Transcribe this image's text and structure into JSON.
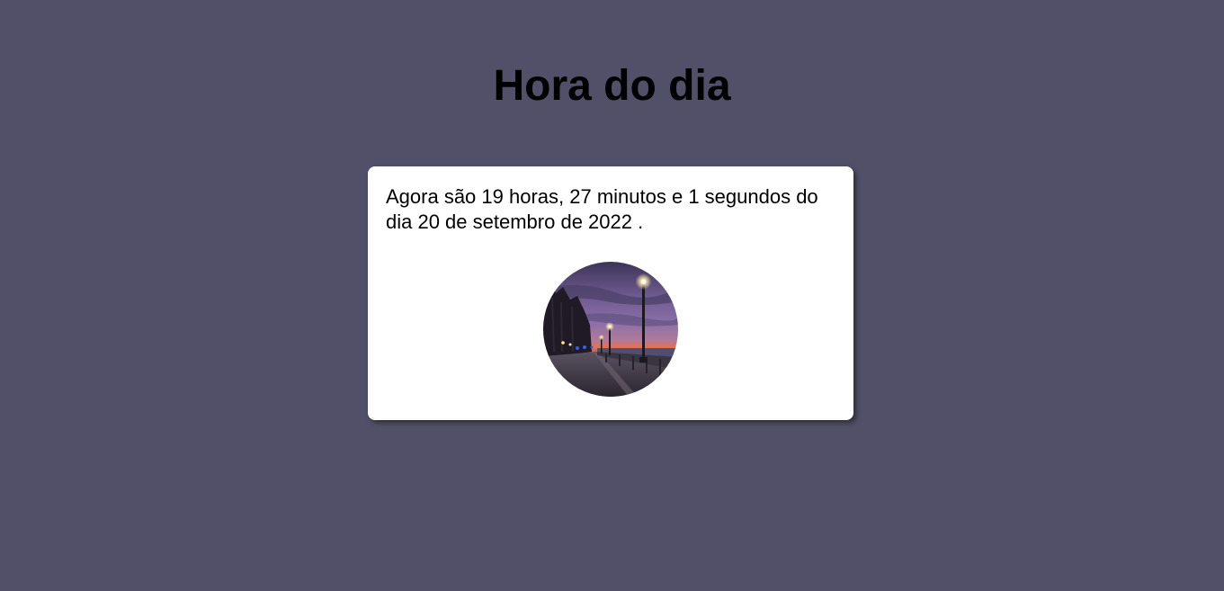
{
  "header": {
    "title": "Hora do dia"
  },
  "card": {
    "message": "Agora são 19 horas, 27 minutos e 1 segundos do dia 20 de setembro de 2022 ."
  },
  "image": {
    "subject": "evening-promenade-photo"
  },
  "colors": {
    "background": "#515068",
    "card": "#ffffff",
    "text": "#000000"
  }
}
